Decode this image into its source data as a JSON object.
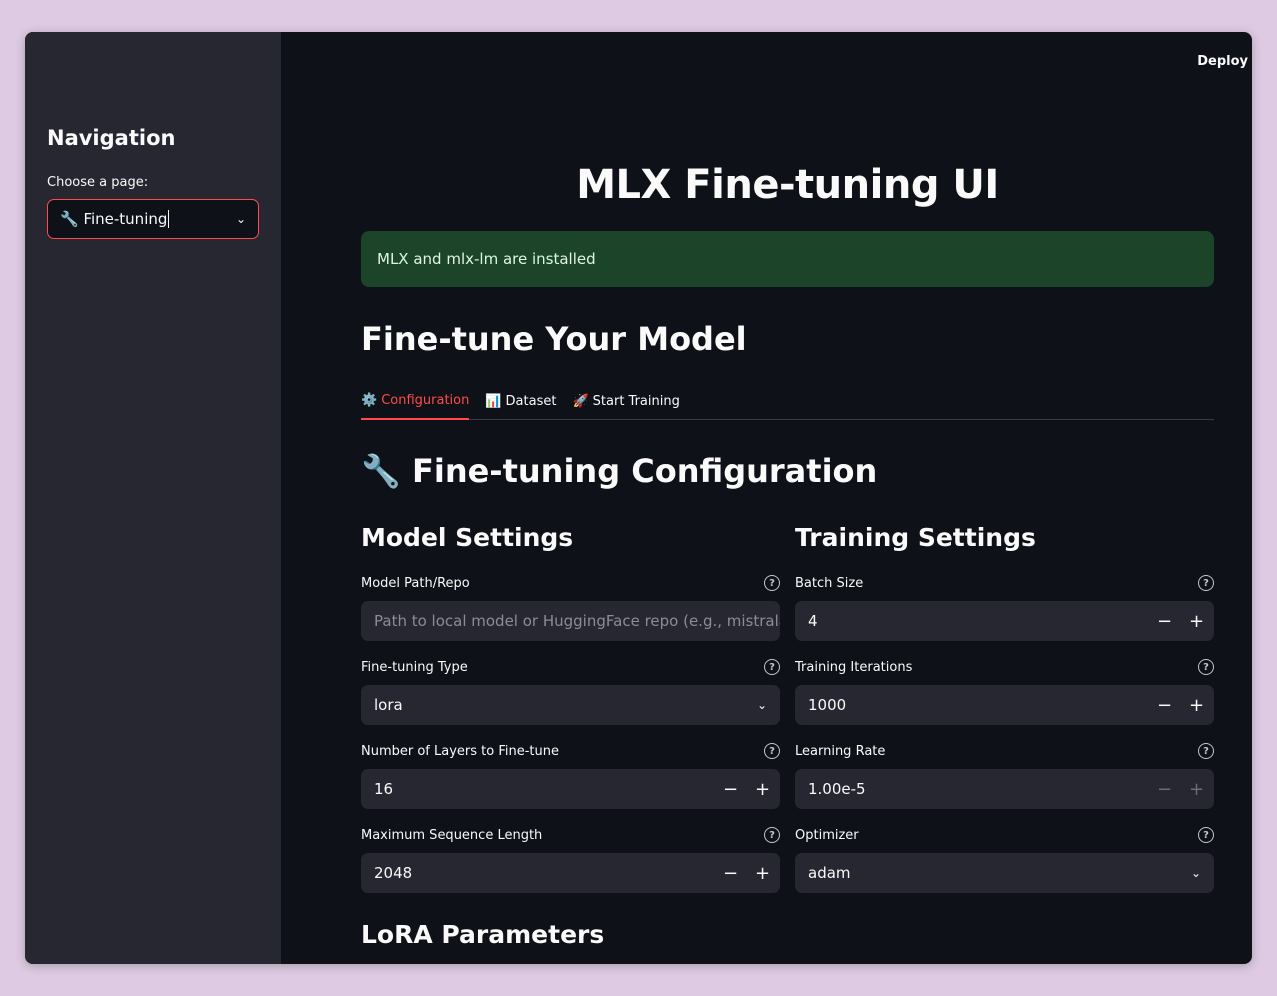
{
  "header": {
    "deploy_label": "Deploy"
  },
  "sidebar": {
    "title": "Navigation",
    "page_label": "Choose a page:",
    "page_value": "🔧 Fine-tuning"
  },
  "main": {
    "title": "MLX Fine-tuning UI",
    "status": "MLX and mlx-lm are installed",
    "section_title": "Fine-tune Your Model",
    "tabs": [
      {
        "icon": "⚙️",
        "label": "Configuration"
      },
      {
        "icon": "📊",
        "label": "Dataset"
      },
      {
        "icon": "🚀",
        "label": "Start Training"
      }
    ],
    "config_title": "🔧 Fine-tuning Configuration",
    "model_settings": {
      "title": "Model Settings",
      "model_path_label": "Model Path/Repo",
      "model_path_placeholder": "Path to local model or HuggingFace repo (e.g., mistralai/Mist",
      "finetune_type_label": "Fine-tuning Type",
      "finetune_type_value": "lora",
      "num_layers_label": "Number of Layers to Fine-tune",
      "num_layers_value": "16",
      "max_seq_label": "Maximum Sequence Length",
      "max_seq_value": "2048"
    },
    "training_settings": {
      "title": "Training Settings",
      "batch_size_label": "Batch Size",
      "batch_size_value": "4",
      "iterations_label": "Training Iterations",
      "iterations_value": "1000",
      "lr_label": "Learning Rate",
      "lr_value": "1.00e-5",
      "optimizer_label": "Optimizer",
      "optimizer_value": "adam"
    },
    "lora_title": "LoRA Parameters"
  },
  "glyphs": {
    "minus": "−",
    "plus": "+",
    "chevron": "⌄",
    "help": "?"
  },
  "colors": {
    "accent": "#ff4b4b",
    "success_bg": "#1c4428",
    "sidebar_bg": "#262730",
    "main_bg": "#0e1117"
  }
}
